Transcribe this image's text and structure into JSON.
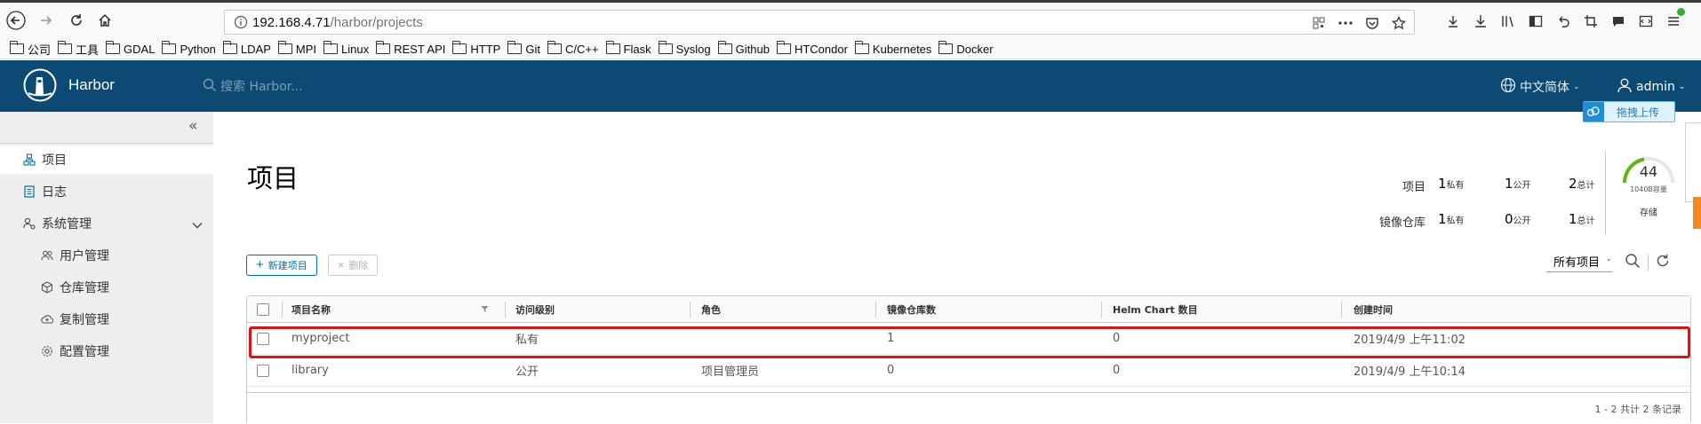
{
  "browser": {
    "url_host": "192.168.4.71",
    "url_path": "/harbor/projects",
    "bookmarks": [
      "公司",
      "工具",
      "GDAL",
      "Python",
      "LDAP",
      "MPI",
      "Linux",
      "REST API",
      "HTTP",
      "Git",
      "C/C++",
      "Flask",
      "Syslog",
      "Github",
      "HTCondor",
      "Kubernetes",
      "Docker"
    ]
  },
  "header": {
    "app_name": "Harbor",
    "search_placeholder": "搜索 Harbor...",
    "language": "中文简体",
    "user": "admin",
    "upload_label": "拖拽上传"
  },
  "sidebar": {
    "items": [
      {
        "label": "项目",
        "icon": "project-icon"
      },
      {
        "label": "日志",
        "icon": "log-icon"
      },
      {
        "label": "系统管理",
        "icon": "admin-icon"
      },
      {
        "label": "用户管理",
        "icon": "users-icon"
      },
      {
        "label": "仓库管理",
        "icon": "registry-icon"
      },
      {
        "label": "复制管理",
        "icon": "replication-icon"
      },
      {
        "label": "配置管理",
        "icon": "config-icon"
      }
    ]
  },
  "main": {
    "title": "项目",
    "stats": {
      "project_label": "项目",
      "repo_label": "镜像仓库",
      "project": {
        "private": "1",
        "public": "1",
        "total": "2"
      },
      "repo": {
        "private": "1",
        "public": "0",
        "total": "1"
      },
      "private_unit": "私有",
      "public_unit": "公开",
      "total_unit": "总计"
    },
    "storage": {
      "value": "44",
      "caption": "1040B容量",
      "label": "存储",
      "level": 0.44
    },
    "new_button": "新建项目",
    "delete_button": "删除",
    "filter_label": "所有项目",
    "columns": [
      "项目名称",
      "访问级别",
      "角色",
      "镜像仓库数",
      "Helm Chart 数目",
      "创建时间"
    ],
    "rows": [
      {
        "name": "myproject",
        "access": "私有",
        "role": "",
        "repos": "1",
        "charts": "0",
        "created": "2019/4/9 上午11:02"
      },
      {
        "name": "library",
        "access": "公开",
        "role": "项目管理员",
        "repos": "0",
        "charts": "0",
        "created": "2019/4/9 上午10:14"
      }
    ],
    "pagination": "1 - 2 共计 2 条记录"
  },
  "colors": {
    "header_bg": "#0d4a73",
    "link": "#0072a3",
    "highlight": "#e01212"
  }
}
